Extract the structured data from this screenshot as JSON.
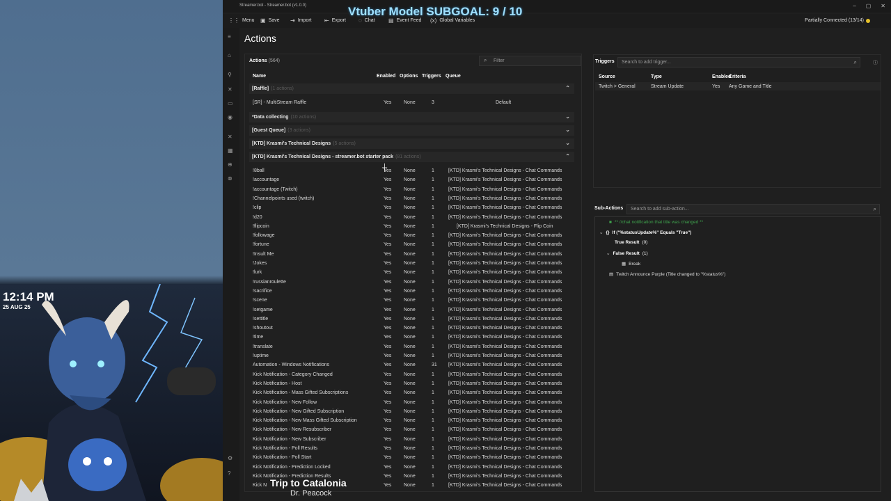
{
  "overlay": {
    "clock": "12:14 PM",
    "date": "25 AUG 25",
    "subgoal": "Vtuber Model SUBGOAL: 9 / 10",
    "song_title": "Trip to Catalonia",
    "song_artist": "Dr. Peacock"
  },
  "window": {
    "title": "Streamer.bot - Streamer.bot (v1.0.0)",
    "controls": [
      "–",
      "▢",
      "✕"
    ]
  },
  "menubar": {
    "menu": "Menu",
    "save": "Save",
    "import": "Import",
    "export": "Export",
    "chat": "Chat",
    "event_feed": "Event Feed",
    "global_variables": "Global Variables",
    "status": "Partially Connected (13/14)",
    "status_color": "#e6c12a"
  },
  "page": {
    "title": "Actions"
  },
  "actions": {
    "title": "Actions",
    "count": "(564)",
    "filter_placeholder": "Filter",
    "columns": {
      "name": "Name",
      "enabled": "Enabled",
      "options": "Options",
      "triggers": "Triggers",
      "queue": "Queue"
    },
    "groups": [
      {
        "label": "[Raffle]",
        "count": "(1 actions)",
        "expanded": true
      },
      {
        "label": "*Data collecting",
        "count": "(10 actions)",
        "expanded": false
      },
      {
        "label": "[Guest Queue]",
        "count": "(3 actions)",
        "expanded": false
      },
      {
        "label": "[KTD] Krasmi's Technical Designs",
        "count": "(5 actions)",
        "expanded": false
      },
      {
        "label": "[KTD] Krasmi's Technical Designs - streamer.bot starter pack",
        "count": "(81 actions)",
        "expanded": true
      }
    ],
    "raffle_row": {
      "name": "[SR] - MultiStream Raffle",
      "enabled": "Yes",
      "options": "None",
      "triggers": "3",
      "queue": "Default"
    },
    "rows": [
      {
        "name": "!8ball",
        "enabled": "Yes",
        "options": "None",
        "triggers": "1",
        "queue": "[KTD] Krasmi's Technical Designs - Chat Commands"
      },
      {
        "name": "!accountage",
        "enabled": "Yes",
        "options": "None",
        "triggers": "1",
        "queue": "[KTD] Krasmi's Technical Designs - Chat Commands"
      },
      {
        "name": "!accountage (Twitch)",
        "enabled": "Yes",
        "options": "None",
        "triggers": "1",
        "queue": "[KTD] Krasmi's Technical Designs - Chat Commands"
      },
      {
        "name": "!Channelpoints used (twitch)",
        "enabled": "Yes",
        "options": "None",
        "triggers": "1",
        "queue": "[KTD] Krasmi's Technical Designs - Chat Commands"
      },
      {
        "name": "!clip",
        "enabled": "Yes",
        "options": "None",
        "triggers": "1",
        "queue": "[KTD] Krasmi's Technical Designs - Chat Commands"
      },
      {
        "name": "!d20",
        "enabled": "Yes",
        "options": "None",
        "triggers": "1",
        "queue": "[KTD] Krasmi's Technical Designs - Chat Commands"
      },
      {
        "name": "!flipcoin",
        "enabled": "Yes",
        "options": "None",
        "triggers": "1",
        "queue": "[KTD] Krasmi's Technical Designs - Flip Coin"
      },
      {
        "name": "!followage",
        "enabled": "Yes",
        "options": "None",
        "triggers": "1",
        "queue": "[KTD] Krasmi's Technical Designs - Chat Commands"
      },
      {
        "name": "!fortune",
        "enabled": "Yes",
        "options": "None",
        "triggers": "1",
        "queue": "[KTD] Krasmi's Technical Designs - Chat Commands"
      },
      {
        "name": "!Insult Me",
        "enabled": "Yes",
        "options": "None",
        "triggers": "1",
        "queue": "[KTD] Krasmi's Technical Designs - Chat Commands"
      },
      {
        "name": "!Jokes",
        "enabled": "Yes",
        "options": "None",
        "triggers": "1",
        "queue": "[KTD] Krasmi's Technical Designs - Chat Commands"
      },
      {
        "name": "!lurk",
        "enabled": "Yes",
        "options": "None",
        "triggers": "1",
        "queue": "[KTD] Krasmi's Technical Designs - Chat Commands"
      },
      {
        "name": "!russianroulette",
        "enabled": "Yes",
        "options": "None",
        "triggers": "1",
        "queue": "[KTD] Krasmi's Technical Designs - Chat Commands"
      },
      {
        "name": "!sacrifice",
        "enabled": "Yes",
        "options": "None",
        "triggers": "1",
        "queue": "[KTD] Krasmi's Technical Designs - Chat Commands"
      },
      {
        "name": "!scene",
        "enabled": "Yes",
        "options": "None",
        "triggers": "1",
        "queue": "[KTD] Krasmi's Technical Designs - Chat Commands"
      },
      {
        "name": "!setgame",
        "enabled": "Yes",
        "options": "None",
        "triggers": "1",
        "queue": "[KTD] Krasmi's Technical Designs - Chat Commands"
      },
      {
        "name": "!settitle",
        "enabled": "Yes",
        "options": "None",
        "triggers": "1",
        "queue": "[KTD] Krasmi's Technical Designs - Chat Commands"
      },
      {
        "name": "!shoutout",
        "enabled": "Yes",
        "options": "None",
        "triggers": "1",
        "queue": "[KTD] Krasmi's Technical Designs - Chat Commands"
      },
      {
        "name": "!time",
        "enabled": "Yes",
        "options": "None",
        "triggers": "1",
        "queue": "[KTD] Krasmi's Technical Designs - Chat Commands"
      },
      {
        "name": "!translate",
        "enabled": "Yes",
        "options": "None",
        "triggers": "1",
        "queue": "[KTD] Krasmi's Technical Designs - Chat Commands"
      },
      {
        "name": "!uptime",
        "enabled": "Yes",
        "options": "None",
        "triggers": "1",
        "queue": "[KTD] Krasmi's Technical Designs - Chat Commands"
      },
      {
        "name": "Automation - Windows Notifications",
        "enabled": "Yes",
        "options": "None",
        "triggers": "31",
        "queue": "[KTD] Krasmi's Technical Designs - Chat Commands"
      },
      {
        "name": "Kick Notification - Category Changed",
        "enabled": "Yes",
        "options": "None",
        "triggers": "1",
        "queue": "[KTD] Krasmi's Technical Designs - Chat Commands"
      },
      {
        "name": "Kick Notification - Host",
        "enabled": "Yes",
        "options": "None",
        "triggers": "1",
        "queue": "[KTD] Krasmi's Technical Designs - Chat Commands"
      },
      {
        "name": "Kick Notification - Mass Gifted Subscriptions",
        "enabled": "Yes",
        "options": "None",
        "triggers": "1",
        "queue": "[KTD] Krasmi's Technical Designs - Chat Commands"
      },
      {
        "name": "Kick Notification - New Follow",
        "enabled": "Yes",
        "options": "None",
        "triggers": "1",
        "queue": "[KTD] Krasmi's Technical Designs - Chat Commands"
      },
      {
        "name": "Kick Notification - New Gifted Subscription",
        "enabled": "Yes",
        "options": "None",
        "triggers": "1",
        "queue": "[KTD] Krasmi's Technical Designs - Chat Commands"
      },
      {
        "name": "Kick Notification - New Mass Gifted Subscription",
        "enabled": "Yes",
        "options": "None",
        "triggers": "1",
        "queue": "[KTD] Krasmi's Technical Designs - Chat Commands"
      },
      {
        "name": "Kick Notification - New Resubscriber",
        "enabled": "Yes",
        "options": "None",
        "triggers": "1",
        "queue": "[KTD] Krasmi's Technical Designs - Chat Commands"
      },
      {
        "name": "Kick Notification - New Subscriber",
        "enabled": "Yes",
        "options": "None",
        "triggers": "1",
        "queue": "[KTD] Krasmi's Technical Designs - Chat Commands"
      },
      {
        "name": "Kick Notification - Poll Results",
        "enabled": "Yes",
        "options": "None",
        "triggers": "1",
        "queue": "[KTD] Krasmi's Technical Designs - Chat Commands"
      },
      {
        "name": "Kick Notification - Poll Start",
        "enabled": "Yes",
        "options": "None",
        "triggers": "1",
        "queue": "[KTD] Krasmi's Technical Designs - Chat Commands"
      },
      {
        "name": "Kick Notification - Prediction Locked",
        "enabled": "Yes",
        "options": "None",
        "triggers": "1",
        "queue": "[KTD] Krasmi's Technical Designs - Chat Commands"
      },
      {
        "name": "Kick Notification - Prediction Results",
        "enabled": "Yes",
        "options": "None",
        "triggers": "1",
        "queue": "[KTD] Krasmi's Technical Designs - Chat Commands"
      },
      {
        "name": "Kick N",
        "enabled": "Yes",
        "options": "None",
        "triggers": "1",
        "queue": "[KTD] Krasmi's Technical Designs - Chat Commands"
      }
    ]
  },
  "triggers": {
    "title": "Triggers",
    "search_placeholder": "Search to add trigger...",
    "columns": {
      "source": "Source",
      "type": "Type",
      "enabled": "Enabled",
      "criteria": "Criteria"
    },
    "row": {
      "source": "Twitch > General",
      "type": "Stream Update",
      "enabled": "Yes",
      "criteria": "Any Game and Title"
    }
  },
  "subactions": {
    "title": "Sub-Actions",
    "search_placeholder": "Search to add sub-action...",
    "comment": "** //chat notification that title was changed **",
    "if_label": "If (\"%statusUpdate%\" Equals \"True\")",
    "true_result": "True Result",
    "true_count": "(0)",
    "false_result": "False Result",
    "false_count": "(1)",
    "break_label": "Break",
    "announce": "Twitch Announce Purple (Title changed to \"%status%\")",
    "comment_color": "#3fa34d"
  }
}
